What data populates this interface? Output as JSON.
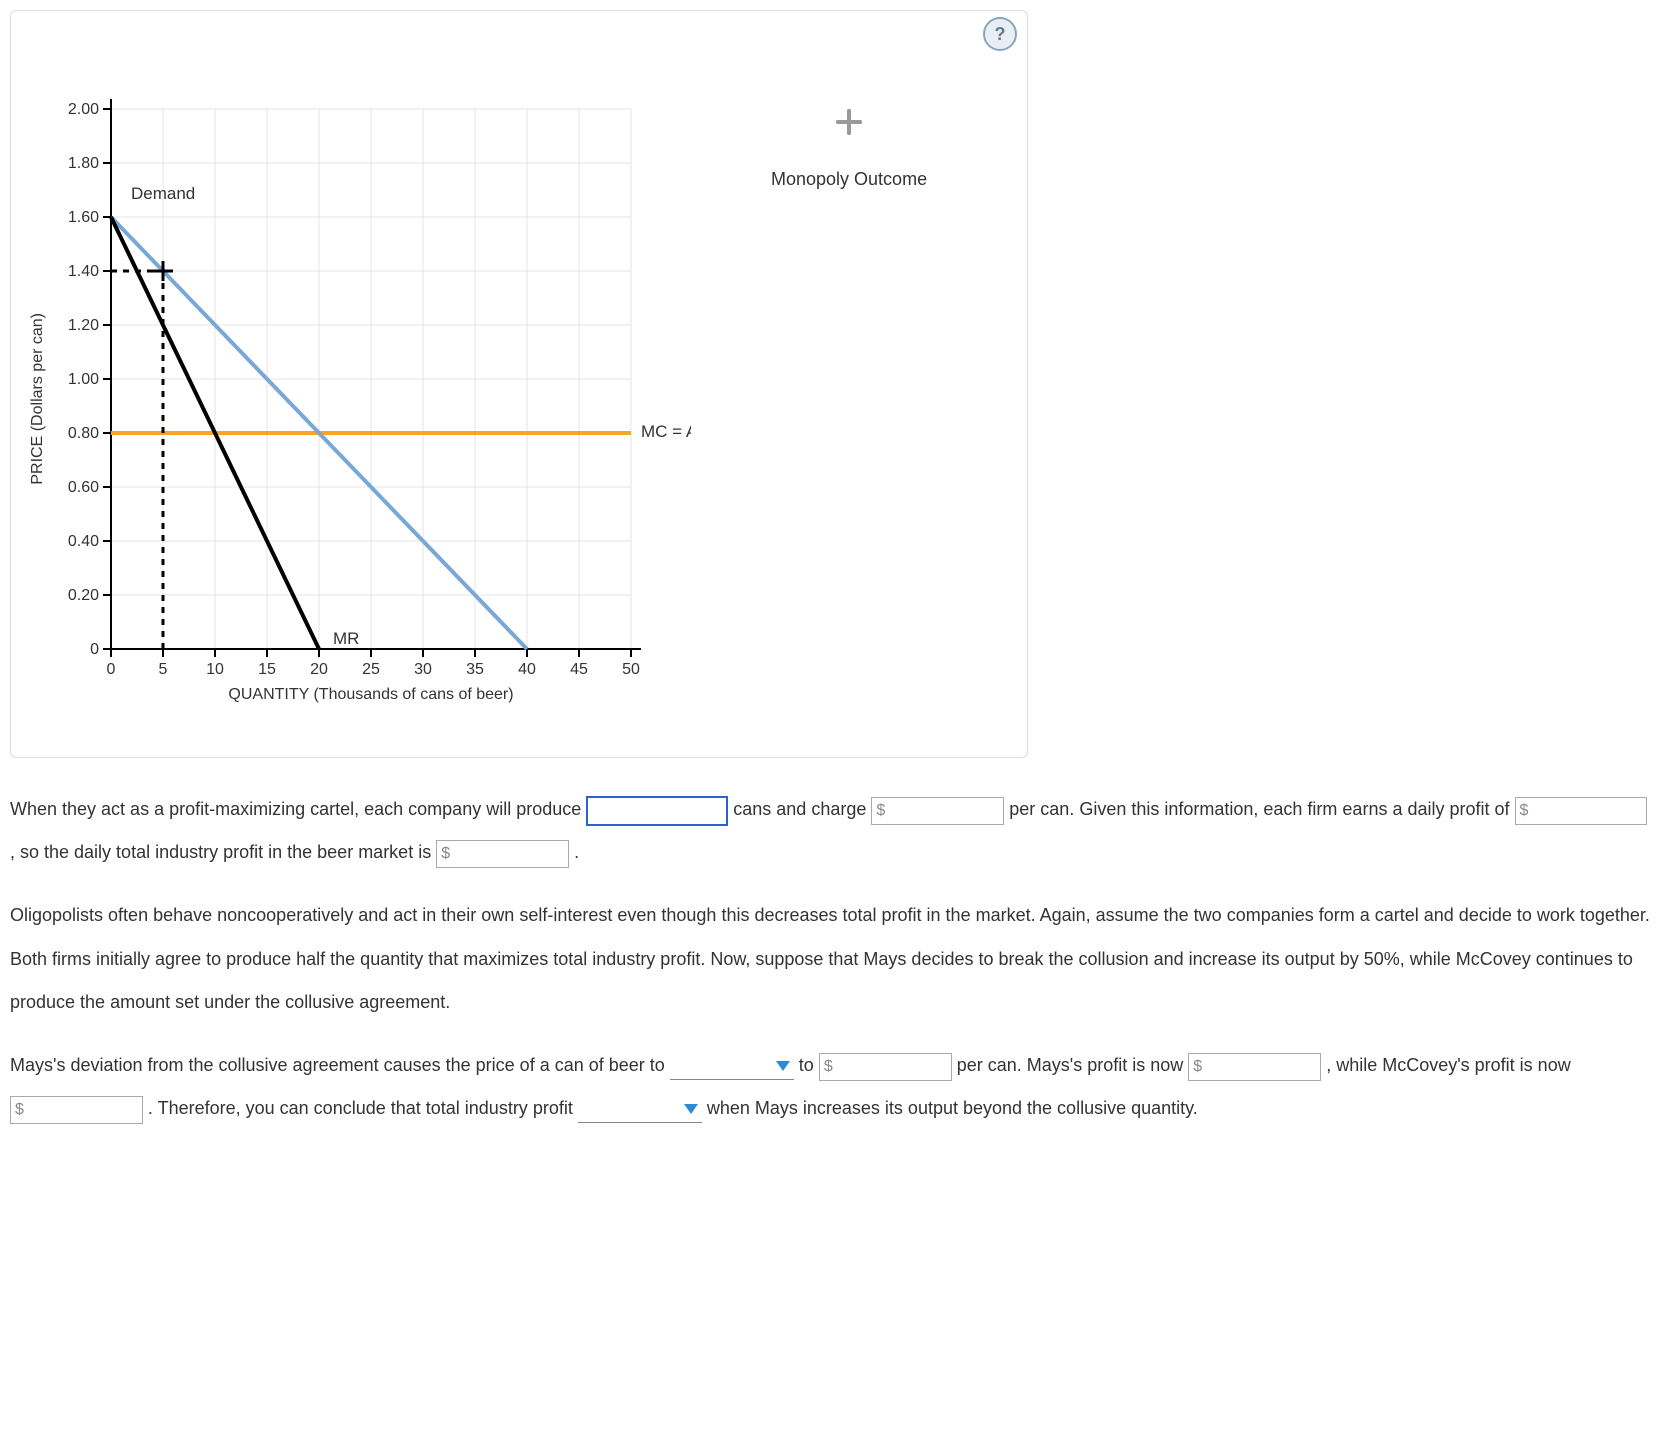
{
  "panel": {
    "help_tooltip": "?"
  },
  "chart_data": {
    "type": "line",
    "title": "",
    "xlabel": "QUANTITY (Thousands of cans of beer)",
    "ylabel": "PRICE (Dollars per can)",
    "xlim": [
      0,
      50
    ],
    "ylim": [
      0,
      2.0
    ],
    "xticks": [
      0,
      5,
      10,
      15,
      20,
      25,
      30,
      35,
      40,
      45,
      50
    ],
    "yticks": [
      0,
      0.2,
      0.4,
      0.6,
      0.8,
      1.0,
      1.2,
      1.4,
      1.6,
      1.8,
      2.0
    ],
    "series": [
      {
        "name": "Demand",
        "points": [
          [
            0,
            1.6
          ],
          [
            40,
            0.0
          ]
        ],
        "color": "#7aa8d6"
      },
      {
        "name": "MR",
        "points": [
          [
            0,
            1.6
          ],
          [
            20,
            0.0
          ]
        ],
        "color": "#000000"
      },
      {
        "name": "MC = ATC",
        "points": [
          [
            0,
            0.8
          ],
          [
            50,
            0.8
          ]
        ],
        "color": "#f5a623"
      }
    ],
    "guides": {
      "dashed_vertical_x": 5,
      "dashed_horizontal_y": 1.4,
      "intersection": [
        5,
        1.4
      ]
    },
    "labels": {
      "demand": "Demand",
      "mr": "MR",
      "mc_atc": "MC = ATC"
    },
    "legend": {
      "marker_symbol": "✥",
      "text": "Monopoly Outcome"
    }
  },
  "q1": {
    "text_a": "When they act as a profit-maximizing cartel, each company will produce ",
    "text_b": " cans and charge ",
    "text_c": " per can. Given this information, each firm earns a daily profit of ",
    "text_d": ", so the daily total industry profit in the beer market is ",
    "text_e": "."
  },
  "para2": "Oligopolists often behave noncooperatively and act in their own self-interest even though this decreases total profit in the market. Again, assume the two companies form a cartel and decide to work together. Both firms initially agree to produce half the quantity that maximizes total industry profit. Now, suppose that Mays decides to break the collusion and increase its output by 50%, while McCovey continues to produce the amount set under the collusive agreement.",
  "q2": {
    "text_a": "Mays's deviation from the collusive agreement causes the price of a can of beer to ",
    "text_b": " to ",
    "text_c": " per can. Mays's profit is now ",
    "text_d": ", while McCovey's profit is now ",
    "text_e": ". Therefore, you can conclude that total industry profit ",
    "text_f": " when Mays increases its output beyond the collusive quantity."
  },
  "currency": "$"
}
